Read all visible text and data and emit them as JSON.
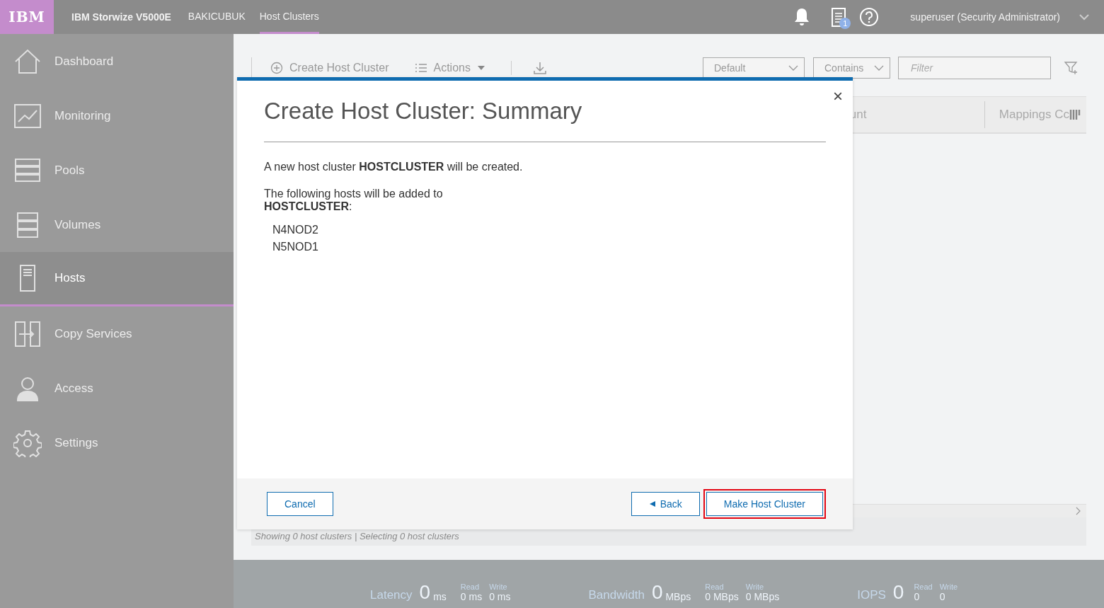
{
  "top_bar": {
    "logo": "IBM",
    "product": "IBM Storwize V5000E",
    "breadcrumbs": [
      {
        "label": "BAKICUBUK",
        "selected": false
      },
      {
        "label": "Host Clusters",
        "selected": true
      }
    ],
    "task_badge": "1",
    "user": "superuser (Security Administrator)"
  },
  "sidebar": {
    "items": [
      {
        "label": "Dashboard",
        "kind": "house",
        "selected": false
      },
      {
        "label": "Monitoring",
        "kind": "graph",
        "selected": false
      },
      {
        "label": "Pools",
        "kind": "stack",
        "selected": false
      },
      {
        "label": "Volumes",
        "kind": "drives",
        "selected": false
      },
      {
        "label": "Hosts",
        "kind": "server",
        "selected": true
      },
      {
        "label": "Copy Services",
        "kind": "copy",
        "selected": false
      },
      {
        "label": "Access",
        "kind": "person",
        "selected": false
      },
      {
        "label": "Settings",
        "kind": "gear",
        "selected": false
      }
    ]
  },
  "toolbar": {
    "create_label": "Create Host Cluster",
    "actions_label": "Actions",
    "view_select": "Default",
    "match_select": "Contains",
    "filter": {
      "placeholder": "Filter"
    }
  },
  "table": {
    "columns": [
      "unt",
      "Mappings Cc"
    ],
    "status": "Showing 0 host clusters | Selecting 0 host clusters"
  },
  "dialog": {
    "title": "Create Host Cluster: Summary",
    "close": "×",
    "message": "A new host cluster **HOSTCLUSTER** will be created.",
    "hosts_intro": "The following hosts will be added to **HOSTCLUSTER**:",
    "hosts": [
      "N4NOD2",
      "N5NOD1"
    ],
    "cancel": "Cancel",
    "back": "Back",
    "primary": {
      "label": "Make Host Cluster",
      "highlighted": true
    }
  },
  "performance": [
    {
      "label": "Latency",
      "value": "0",
      "unit": "ms",
      "read_label": "Read",
      "read": "0 ms",
      "write_label": "Write",
      "write": "0 ms"
    },
    {
      "label": "Bandwidth",
      "value": "0",
      "unit": "MBps",
      "read_label": "Read",
      "read": "0 MBps",
      "write_label": "Write",
      "write": "0 MBps"
    },
    {
      "label": "IOPS",
      "value": "0",
      "read_label": "Read",
      "read": "0",
      "write_label": "Write",
      "write": "0"
    }
  ]
}
